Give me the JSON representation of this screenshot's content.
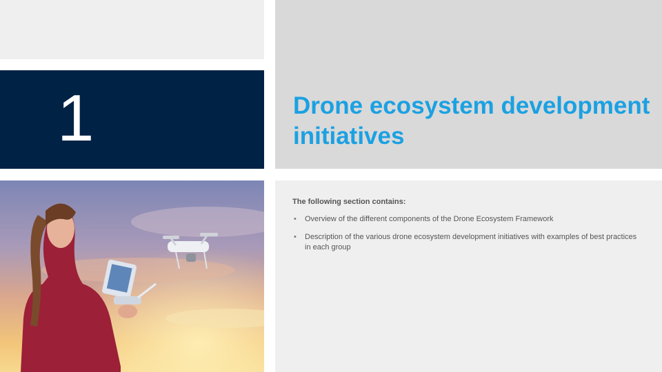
{
  "section": {
    "number": "1",
    "title": "Drone ecosystem development initiatives"
  },
  "body": {
    "intro": "The following section contains:",
    "bullets": [
      "Overview of the different components of the Drone Ecosystem Framework",
      "Description of the various drone ecosystem development initiatives with examples of best practices in each group"
    ]
  },
  "colors": {
    "number_panel": "#002245",
    "title_text": "#1ba1e2",
    "title_panel": "#d9d9d9",
    "body_panel": "#efefef"
  },
  "photo": {
    "icon": "girl-flying-drone-photo"
  }
}
